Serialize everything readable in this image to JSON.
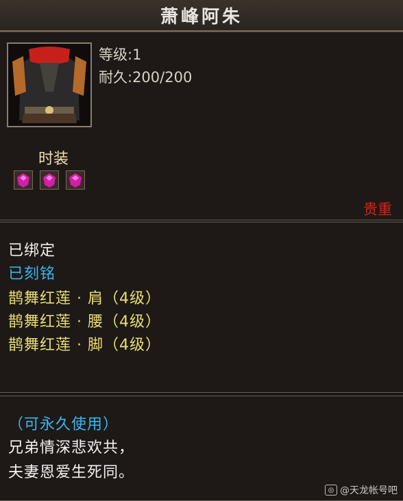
{
  "window": {
    "title": "萧峰阿朱"
  },
  "item": {
    "level_label": "等级:1",
    "durability_label": "耐久:200/200",
    "type": "时装",
    "grade": "贵重",
    "gems": [
      "gem-icon",
      "gem-icon",
      "gem-icon"
    ]
  },
  "binding": {
    "bound": "已绑定",
    "engraved": "已刻铭"
  },
  "set_items": [
    "鹊舞红莲 · 肩（4级）",
    "鹊舞红莲 · 腰（4级）",
    "鹊舞红莲 · 脚（4级）"
  ],
  "description": {
    "permanent": "（可永久使用）",
    "line1": "兄弟情深悲欢共，",
    "line2": "夫妻恩爱生死同。"
  },
  "watermark": {
    "text": "@天龙帐号吧"
  },
  "colors": {
    "title": "#e9e6e2",
    "blue": "#36b7f2",
    "yellow": "#e8df72",
    "red": "#d8221a",
    "type": "#f0e0b0"
  }
}
